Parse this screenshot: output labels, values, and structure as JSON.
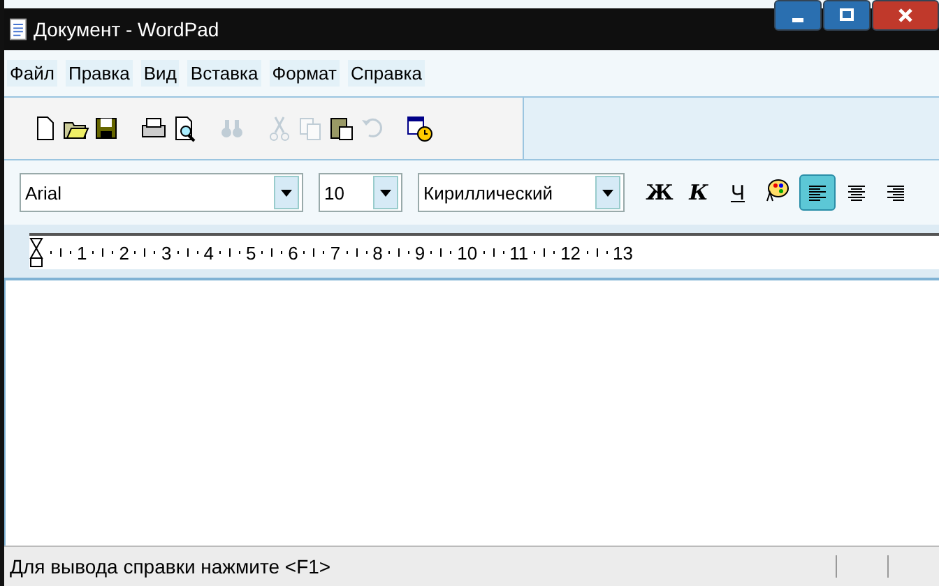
{
  "window": {
    "title": "Документ - WordPad"
  },
  "menu": [
    "Файл",
    "Правка",
    "Вид",
    "Вставка",
    "Формат",
    "Справка"
  ],
  "toolbar": [
    {
      "kind": "new",
      "disabled": false
    },
    {
      "kind": "open",
      "disabled": false
    },
    {
      "kind": "save",
      "disabled": false
    },
    {
      "kind": "print",
      "disabled": false
    },
    {
      "kind": "preview",
      "disabled": false
    },
    {
      "kind": "find",
      "disabled": true
    },
    {
      "kind": "cut",
      "disabled": true
    },
    {
      "kind": "copy",
      "disabled": true
    },
    {
      "kind": "paste",
      "disabled": false
    },
    {
      "kind": "undo",
      "disabled": true
    },
    {
      "kind": "datetime",
      "disabled": false
    }
  ],
  "format_bar": {
    "font": "Arial",
    "size": "10",
    "script": "Кириллический",
    "style_buttons": [
      "Ж",
      "К",
      "Ч"
    ],
    "align": [
      {
        "kind": "left",
        "selected": true
      },
      {
        "kind": "center",
        "selected": false
      },
      {
        "kind": "right",
        "selected": false
      }
    ]
  },
  "ruler": [
    "1",
    "2",
    "3",
    "4",
    "5",
    "6",
    "7",
    "8",
    "9",
    "10",
    "11",
    "12",
    "13"
  ],
  "status_bar": {
    "text": "Для вывода справки нажмите <F1>"
  }
}
